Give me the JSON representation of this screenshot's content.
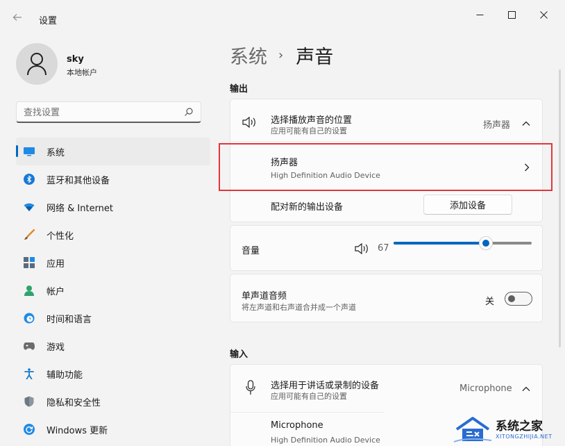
{
  "window": {
    "title": "设置",
    "back_icon": "arrow-left-icon",
    "controls": [
      "minimize-icon",
      "maximize-icon",
      "close-icon"
    ]
  },
  "profile": {
    "name": "sky",
    "account_type": "本地帐户"
  },
  "search": {
    "placeholder": "查找设置"
  },
  "sidebar": {
    "items": [
      {
        "label": "系统",
        "icon": "monitor-icon",
        "active": true
      },
      {
        "label": "蓝牙和其他设备",
        "icon": "bluetooth-icon"
      },
      {
        "label": "网络 & Internet",
        "icon": "wifi-icon"
      },
      {
        "label": "个性化",
        "icon": "paintbrush-icon"
      },
      {
        "label": "应用",
        "icon": "apps-icon"
      },
      {
        "label": "帐户",
        "icon": "person-icon"
      },
      {
        "label": "时间和语言",
        "icon": "globe-clock-icon"
      },
      {
        "label": "游戏",
        "icon": "gamepad-icon"
      },
      {
        "label": "辅助功能",
        "icon": "accessibility-icon"
      },
      {
        "label": "隐私和安全性",
        "icon": "shield-icon"
      },
      {
        "label": "Windows 更新",
        "icon": "update-icon"
      }
    ]
  },
  "breadcrumb": {
    "parent": "系统",
    "separator": "›",
    "current": "声音"
  },
  "output": {
    "section_label": "输出",
    "choose_title": "选择播放声音的位置",
    "choose_subtitle": "应用可能有自己的设置",
    "choose_value": "扬声器",
    "device_name": "扬声器",
    "device_desc": "High Definition Audio Device",
    "pair_label": "配对新的输出设备",
    "add_device_button": "添加设备"
  },
  "volume": {
    "label": "音量",
    "value": "67",
    "level": 0.67
  },
  "mono": {
    "title": "单声道音频",
    "subtitle": "将左声道和右声道合并成一个声道",
    "state_label": "关",
    "on": false
  },
  "input": {
    "section_label": "输入",
    "choose_title": "选择用于讲话或录制的设备",
    "choose_subtitle": "应用可能有自己的设置",
    "choose_value": "Microphone",
    "device_name": "Microphone",
    "device_desc": "High Definition Audio Device"
  },
  "watermark": {
    "main": "系统之家",
    "sub": "XITONGZHIJIA.NET"
  },
  "colors": {
    "accent": "#0067c0",
    "highlight": "#e0363c"
  }
}
